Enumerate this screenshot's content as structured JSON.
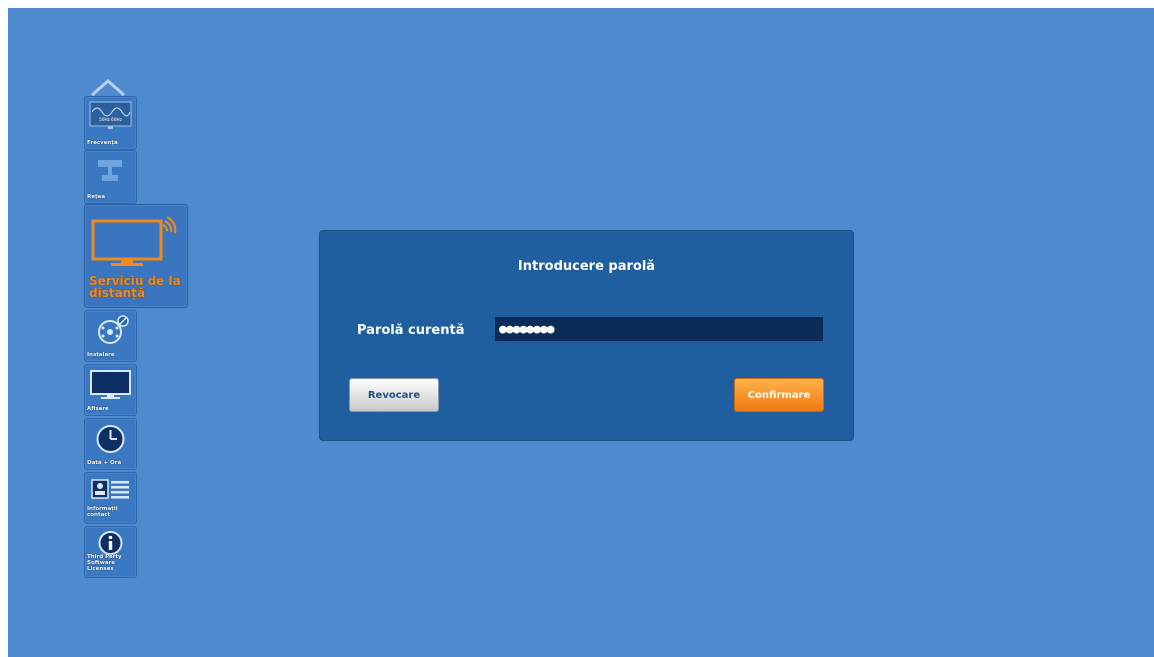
{
  "sidebar": {
    "items": [
      {
        "label": "Frecvență",
        "icon": "frequency-icon",
        "icon_text": "50Hz 60Hz"
      },
      {
        "label": "Rețea",
        "icon": "network-icon"
      },
      {
        "label": "Serviciu de la distanță",
        "icon": "remote-service-icon"
      },
      {
        "label": "Instalare",
        "icon": "install-icon"
      },
      {
        "label": "Afișare",
        "icon": "display-icon"
      },
      {
        "label": "Dată + Oră",
        "icon": "clock-icon"
      },
      {
        "label": "Informații contact",
        "icon": "contact-card-icon"
      },
      {
        "label": "Third Party Software Licenses",
        "icon": "info-icon"
      }
    ]
  },
  "dialog": {
    "title": "Introducere parolă",
    "password_label": "Parolă curentă",
    "password_value": "●●●●●●●●",
    "cancel_label": "Revocare",
    "confirm_label": "Confirmare"
  },
  "colors": {
    "background": "#4e8bce",
    "dialog": "#1f5f9f",
    "accent": "#f08a1c",
    "field": "#0b2b59"
  }
}
